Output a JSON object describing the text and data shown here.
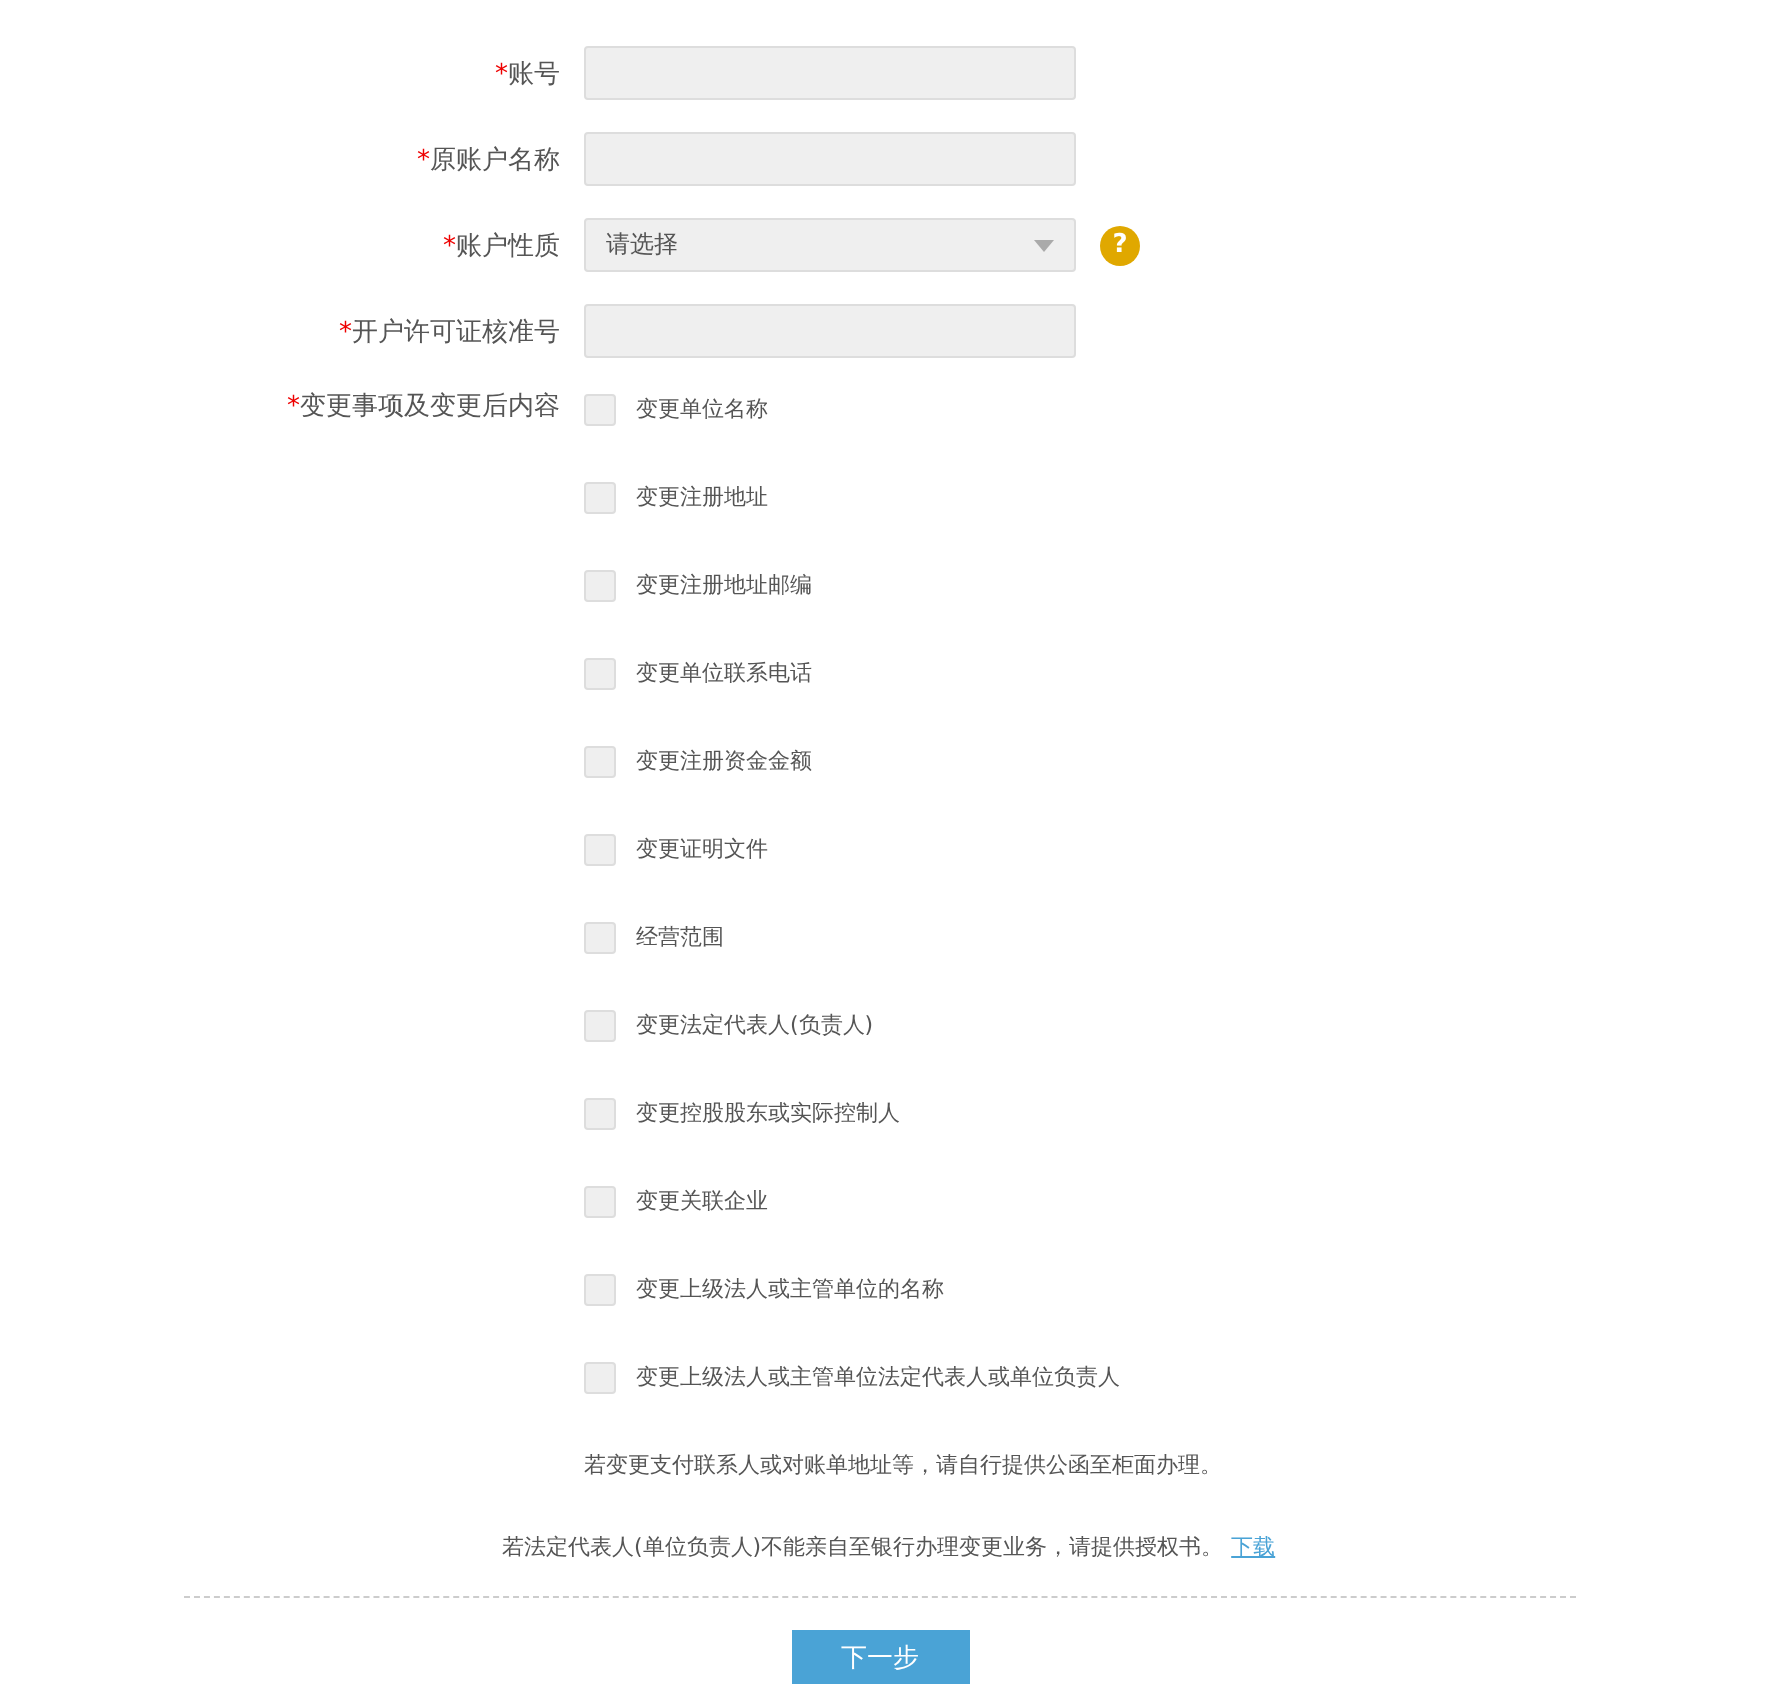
{
  "fields": [
    {
      "required_mark": "*",
      "label": "账号",
      "kind": "text"
    },
    {
      "required_mark": "*",
      "label": "原账户名称",
      "kind": "text"
    },
    {
      "required_mark": "*",
      "label": "账户性质",
      "kind": "select",
      "placeholder": "请选择",
      "help": "?"
    },
    {
      "required_mark": "*",
      "label": "开户许可证核准号",
      "kind": "text"
    }
  ],
  "changes": {
    "required_mark": "*",
    "label": "变更事项及变更后内容",
    "options": [
      {
        "label": "变更单位名称",
        "checked": false
      },
      {
        "label": "变更注册地址",
        "checked": false
      },
      {
        "label": "变更注册地址邮编",
        "checked": false
      },
      {
        "label": "变更单位联系电话",
        "checked": false
      },
      {
        "label": "变更注册资金金额",
        "checked": false
      },
      {
        "label": "变更证明文件",
        "checked": false
      },
      {
        "label": "经营范围",
        "checked": false
      },
      {
        "label": "变更法定代表人(负责人)",
        "checked": false
      },
      {
        "label": "变更控股股东或实际控制人",
        "checked": false
      },
      {
        "label": "变更关联企业",
        "checked": false
      },
      {
        "label": "变更上级法人或主管单位的名称",
        "checked": false
      },
      {
        "label": "变更上级法人或主管单位法定代表人或单位负责人",
        "checked": false
      }
    ]
  },
  "note1": "若变更支付联系人或对账单地址等，请自行提供公函至柜面办理。",
  "note2": "若法定代表人(单位负责人)不能亲自至银行办理变更业务，请提供授权书。",
  "download_link": "下载",
  "next_button": "下一步"
}
